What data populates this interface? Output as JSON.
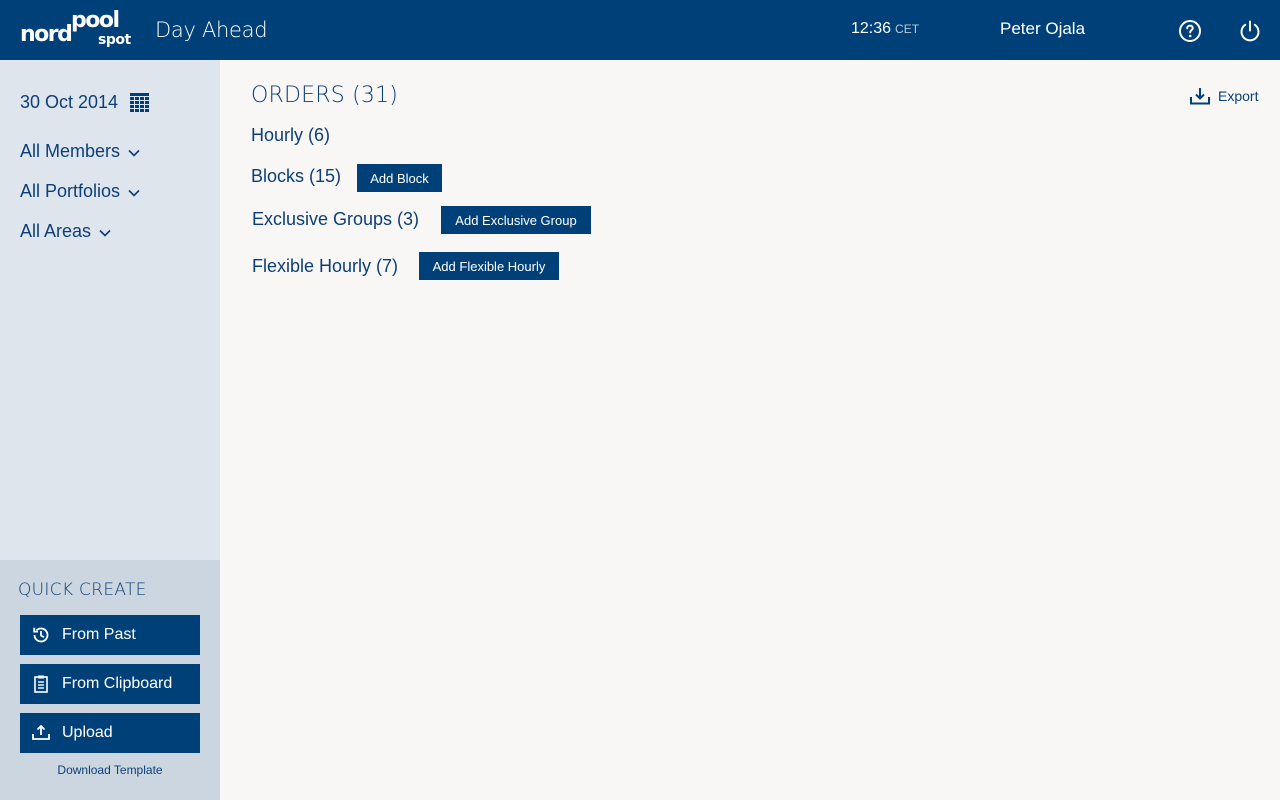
{
  "header": {
    "logo": {
      "word1": "nord",
      "word2": "pool",
      "word3": "spot"
    },
    "app_title": "Day Ahead",
    "time": "12:36",
    "timezone": "CET",
    "user_name": "Peter Ojala"
  },
  "sidebar": {
    "date": "30 Oct 2014",
    "filters": [
      "All Members",
      "All Portfolios",
      "All Areas"
    ]
  },
  "quick_create": {
    "title": "QUICK CREATE",
    "buttons": [
      "From Past",
      "From Clipboard",
      "Upload"
    ],
    "download_template": "Download Template"
  },
  "main": {
    "title": "ORDERS (31)",
    "export_label": "Export",
    "sections": [
      {
        "label": "Hourly (6)"
      },
      {
        "label": "Blocks (15)",
        "button": "Add Block"
      },
      {
        "label": "Exclusive Groups (3)",
        "button": "Add Exclusive Group"
      },
      {
        "label": "Flexible Hourly (7)",
        "button": "Add Flexible Hourly"
      }
    ]
  },
  "colors": {
    "brand_blue": "#004078",
    "text_blue": "#0c3f78",
    "sidebar_bg": "#dfe5ec",
    "quick_create_bg": "#ccd6e1",
    "content_bg": "#f8f7f5"
  }
}
